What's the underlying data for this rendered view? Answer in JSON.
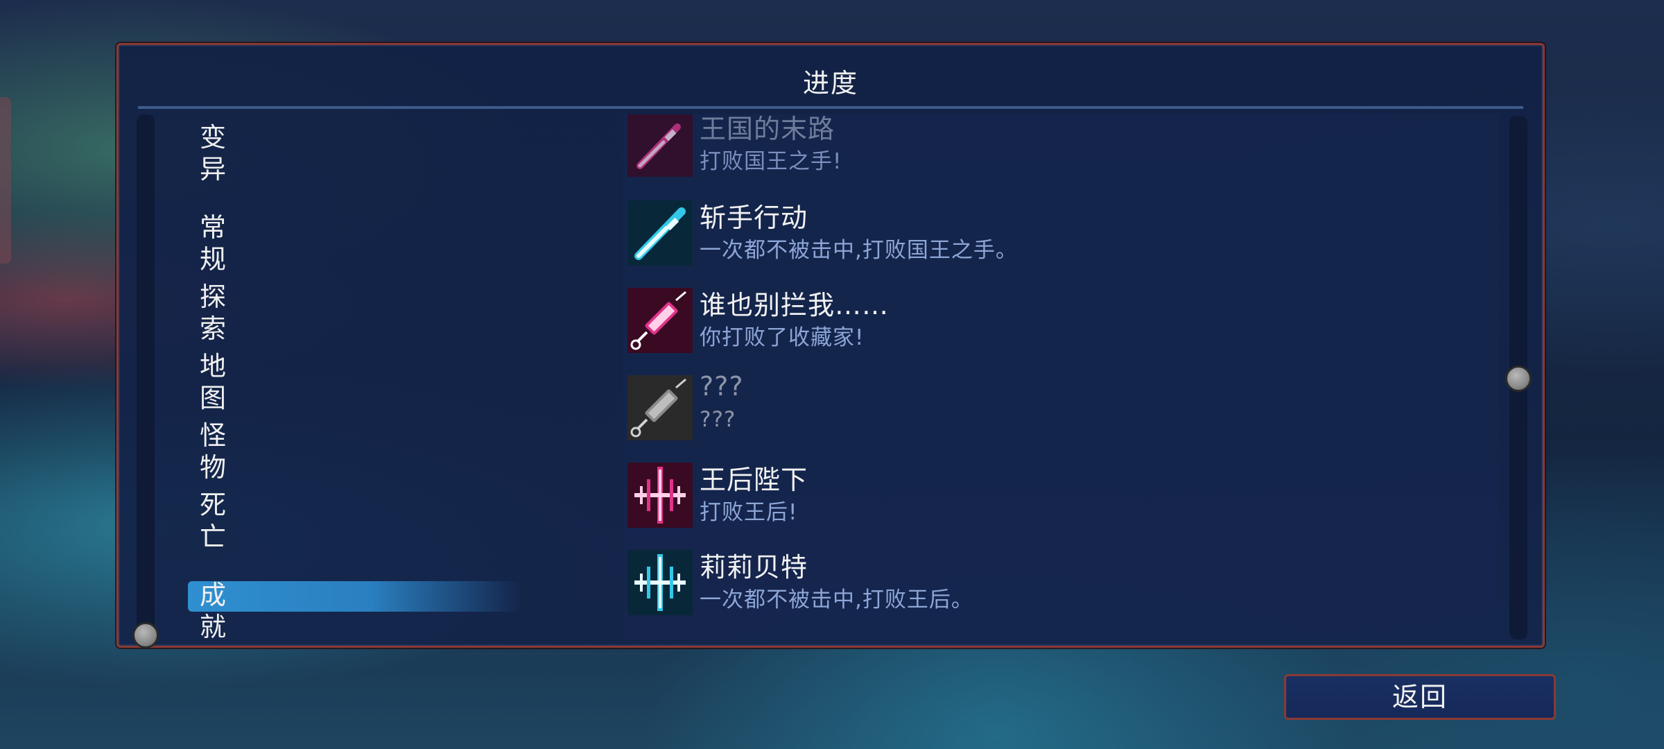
{
  "window": {
    "title": "进度"
  },
  "categories": [
    {
      "label": "变异",
      "active": false
    },
    {
      "label": "常规",
      "active": false
    },
    {
      "label": "探索",
      "active": false
    },
    {
      "label": "地图",
      "active": false
    },
    {
      "label": "怪物",
      "active": false
    },
    {
      "label": "死亡",
      "active": false
    },
    {
      "label": "成就",
      "active": true
    }
  ],
  "achievements": [
    {
      "name": "王国的末路",
      "desc": "打败国王之手!",
      "icon": "sword-icon",
      "color": "#e0338a",
      "state": "faded"
    },
    {
      "name": "斩手行动",
      "desc": "一次都不被击中,打败国王之手。",
      "icon": "sword-icon",
      "color": "#33c8e8",
      "state": "unlocked"
    },
    {
      "name": "谁也别拦我……",
      "desc": "你打败了收藏家!",
      "icon": "syringe-icon",
      "color": "#e0338a",
      "state": "unlocked"
    },
    {
      "name": "???",
      "desc": "???",
      "icon": "syringe-icon",
      "color": "#9a9a9a",
      "state": "locked"
    },
    {
      "name": "王后陛下",
      "desc": "打败王后!",
      "icon": "sparkle-icon",
      "color": "#e0338a",
      "state": "unlocked"
    },
    {
      "name": "莉莉贝特",
      "desc": "一次都不被击中,打败王后。",
      "icon": "sparkle-icon",
      "color": "#33c8e8",
      "state": "unlocked"
    }
  ],
  "buttons": {
    "back": "返回"
  },
  "colors": {
    "frame": "#8a3a34",
    "panel": "#14244a",
    "accent_cyan": "#33c8e8",
    "accent_pink": "#e0338a",
    "active_tab": "#2f8fd0"
  }
}
